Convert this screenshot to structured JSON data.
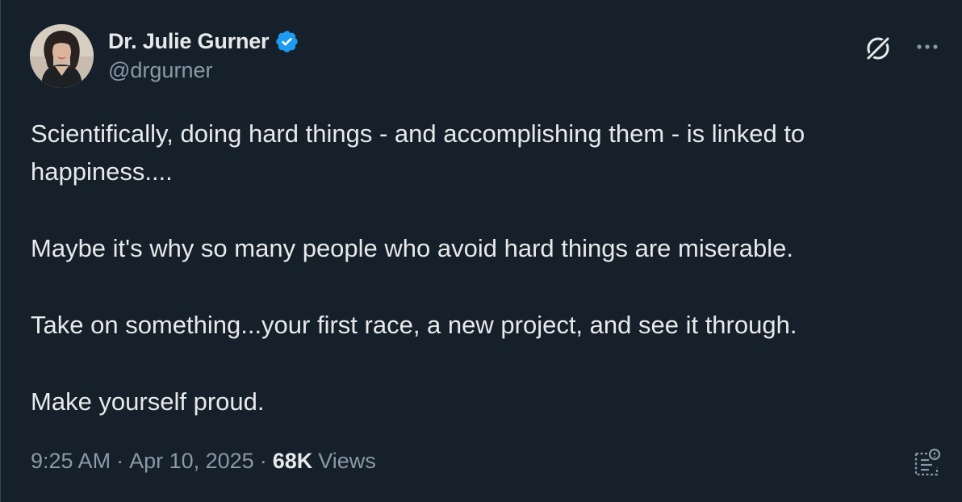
{
  "author": {
    "display_name": "Dr. Julie Gurner",
    "handle": "@drgurner",
    "verified": true,
    "verified_color": "#1d9bf0"
  },
  "tweet": {
    "paragraphs": [
      "Scientifically, doing hard things - and accomplishing them - is linked to happiness....",
      "Maybe it's why so many people who avoid hard things are miserable.",
      "Take on something...your first race, a new project, and see it through.",
      "Make yourself proud."
    ]
  },
  "meta": {
    "time": "9:25 AM",
    "separator": "·",
    "date": "Apr 10, 2025",
    "views_count": "68K",
    "views_label": "Views"
  },
  "icons": {
    "verified": "verified-badge-icon",
    "grok": "grok-icon",
    "more": "more-options-icon",
    "post_analytics": "post-analytics-icon"
  },
  "colors": {
    "background": "#15202b",
    "text_primary": "#e7e9ea",
    "text_secondary": "#8b98a5",
    "accent": "#1d9bf0"
  }
}
